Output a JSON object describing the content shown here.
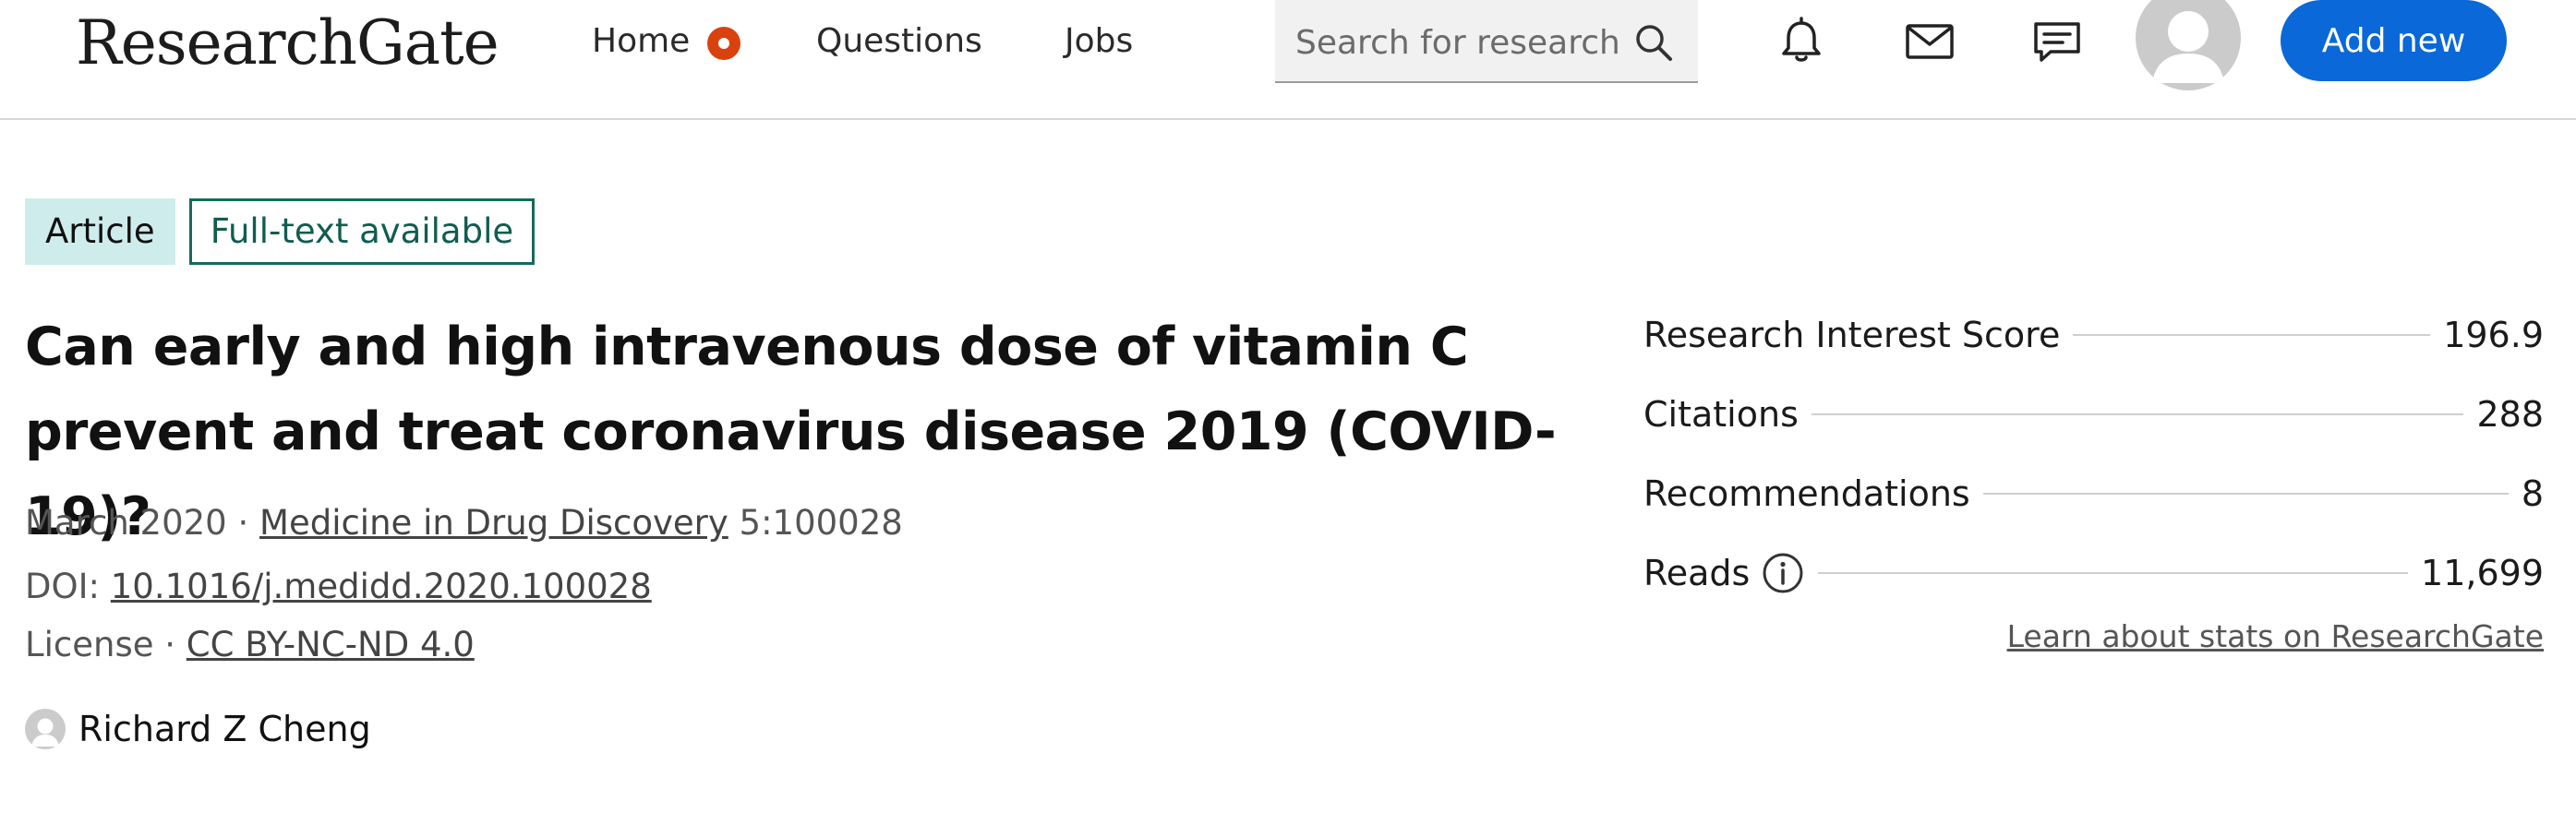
{
  "header": {
    "logo": "ResearchGate",
    "nav": [
      {
        "label": "Home"
      },
      {
        "label": "Questions"
      },
      {
        "label": "Jobs"
      }
    ],
    "search_placeholder": "Search for research",
    "add_new_label": "Add new"
  },
  "article": {
    "badges": [
      "Article",
      "Full-text available"
    ],
    "title": "Can early and high intravenous dose of vitamin C prevent and treat coronavirus disease 2019 (COVID-19)?",
    "date": "March 2020",
    "separator": "·",
    "journal": "Medicine in Drug Discovery",
    "volume": "5:100028",
    "doi_label": "DOI:",
    "doi": "10.1016/j.medidd.2020.100028",
    "license_label": "License",
    "license": "CC BY-NC-ND 4.0",
    "author": "Richard Z Cheng"
  },
  "stats": {
    "rows": [
      {
        "label": "Research Interest Score",
        "value": "196.9"
      },
      {
        "label": "Citations",
        "value": "288"
      },
      {
        "label": "Recommendations",
        "value": "8"
      },
      {
        "label": "Reads",
        "value": "11,699"
      }
    ],
    "learn_link": "Learn about stats on ResearchGate"
  },
  "colors": {
    "accent_blue": "#0a68d8",
    "home_badge": "#d9410f",
    "article_badge_bg": "#cfecec",
    "fulltext_border": "#166a5c"
  },
  "icons": [
    "search-icon",
    "bell-icon",
    "mail-icon",
    "chat-icon",
    "avatar-icon",
    "info-icon"
  ]
}
